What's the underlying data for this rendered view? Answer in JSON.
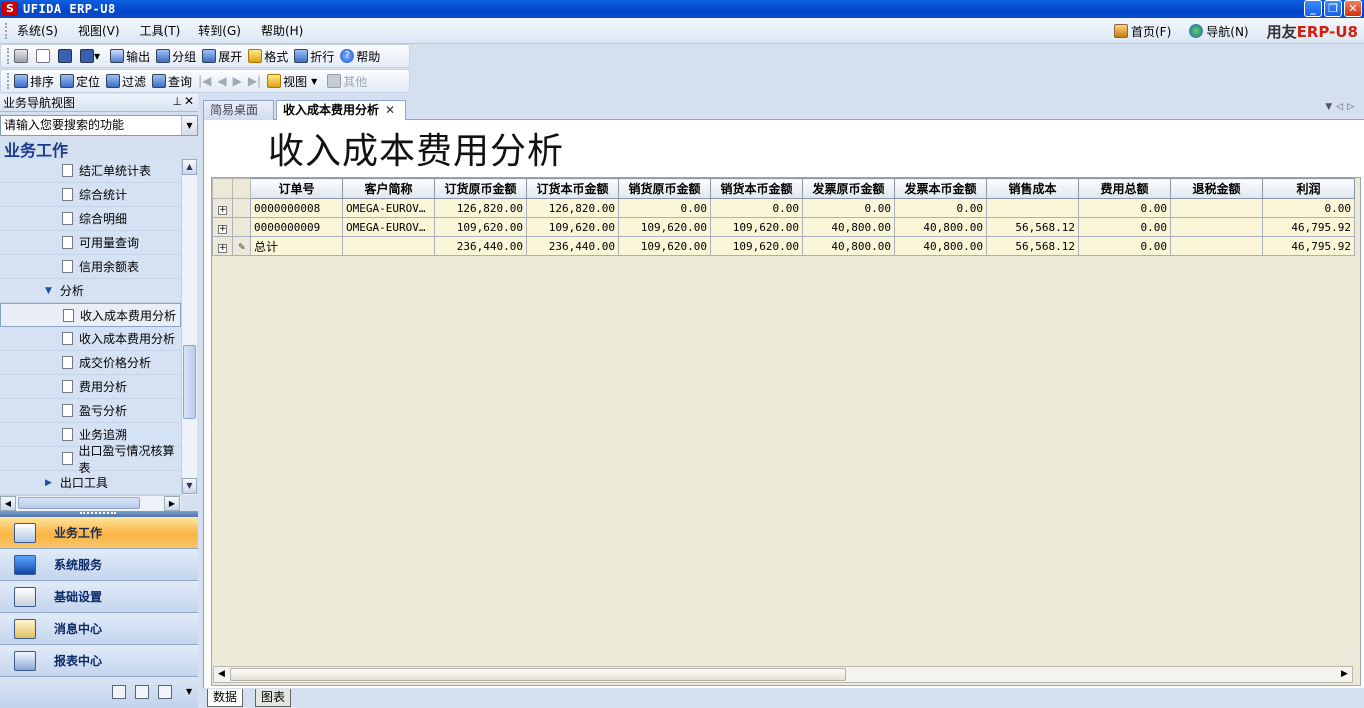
{
  "window": {
    "title": "UFIDA ERP-U8",
    "logo": "S",
    "controls": [
      "minimize-icon",
      "restore-icon",
      "close-icon"
    ]
  },
  "menu": {
    "items": [
      "系统(S)",
      "视图(V)",
      "工具(T)",
      "转到(G)",
      "帮助(H)"
    ],
    "right": {
      "home": "首页(F)",
      "nav": "导航(N)"
    },
    "brand": {
      "a": "用友",
      "b": "ERP-U8"
    }
  },
  "toolbar1": {
    "output": "输出",
    "group": "分组",
    "expand": "展开",
    "format": "格式",
    "fold": "折行",
    "help": "帮助"
  },
  "toolbar2": {
    "sort": "排序",
    "locate": "定位",
    "filter": "过滤",
    "query": "查询",
    "view": "视图",
    "other": "其他"
  },
  "nav": {
    "header": "业务导航视图",
    "search_placeholder": "请输入您要搜索的功能",
    "section": "业务工作",
    "items": [
      {
        "label": "结汇单统计表"
      },
      {
        "label": "综合统计"
      },
      {
        "label": "综合明细"
      },
      {
        "label": "可用量查询"
      },
      {
        "label": "信用余额表"
      },
      {
        "label": "分析"
      },
      {
        "label": "收入成本费用分析"
      },
      {
        "label": "收入成本费用分析"
      },
      {
        "label": "成交价格分析"
      },
      {
        "label": "费用分析"
      },
      {
        "label": "盈亏分析"
      },
      {
        "label": "业务追溯"
      },
      {
        "label": "出口盈亏情况核算表"
      },
      {
        "label": "出口工具"
      }
    ],
    "groups": [
      "业务工作",
      "系统服务",
      "基础设置",
      "消息中心",
      "报表中心"
    ]
  },
  "tabs": {
    "t1": "简易桌面",
    "t2": "收入成本费用分析"
  },
  "report": {
    "title": "收入成本费用分析",
    "columns": [
      "订单号",
      "客户简称",
      "订货原币金额",
      "订货本币金额",
      "销货原币金额",
      "销货本币金额",
      "发票原币金额",
      "发票本币金额",
      "销售成本",
      "费用总额",
      "退税金额",
      "利润"
    ],
    "rows": [
      [
        "0000000008",
        "OMEGA-EUROV…",
        "126,820.00",
        "126,820.00",
        "0.00",
        "0.00",
        "0.00",
        "0.00",
        "",
        "0.00",
        "",
        "0.00"
      ],
      [
        "0000000009",
        "OMEGA-EUROV…",
        "109,620.00",
        "109,620.00",
        "109,620.00",
        "109,620.00",
        "40,800.00",
        "40,800.00",
        "56,568.12",
        "0.00",
        "",
        "46,795.92"
      ]
    ],
    "total": [
      "总计",
      "",
      "236,440.00",
      "236,440.00",
      "109,620.00",
      "109,620.00",
      "40,800.00",
      "40,800.00",
      "56,568.12",
      "0.00",
      "",
      "46,795.92"
    ]
  },
  "bottom_tabs": {
    "data": "数据",
    "chart": "图表"
  }
}
